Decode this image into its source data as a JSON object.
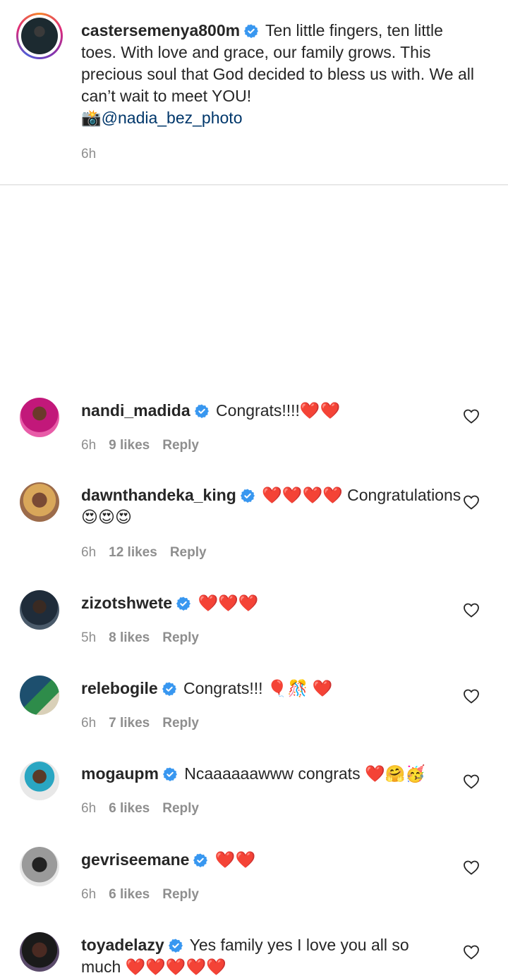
{
  "caption": {
    "username": "castersemenya800m",
    "text": "Ten little fingers, ten little toes. With love and grace, our family grows. This precious soul that God decided to bless us with. We all can’t wait to meet YOU!",
    "camera_emoji": "📸",
    "mention": "@nadia_bez_photo",
    "time": "6h"
  },
  "comments": [
    {
      "username": "nandi_madida",
      "text": "Congrats!!!!❤️❤️",
      "time": "6h",
      "likes": "9 likes",
      "reply": "Reply"
    },
    {
      "username": "dawnthandeka_king",
      "text": "❤️❤️❤️❤️ Congratulations 😍😍😍",
      "time": "6h",
      "likes": "12 likes",
      "reply": "Reply"
    },
    {
      "username": "zizotshwete",
      "text": "❤️❤️❤️",
      "time": "5h",
      "likes": "8 likes",
      "reply": "Reply"
    },
    {
      "username": "relebogile",
      "text": "Congrats!!! 🎈🎊 ❤️",
      "time": "6h",
      "likes": "7 likes",
      "reply": "Reply"
    },
    {
      "username": "mogaupm",
      "text": "Ncaaaaaawww congrats ❤️🤗🥳",
      "time": "6h",
      "likes": "6 likes",
      "reply": "Reply"
    },
    {
      "username": "gevriseemane",
      "text": "❤️❤️",
      "time": "6h",
      "likes": "6 likes",
      "reply": "Reply"
    },
    {
      "username": "toyadelazy",
      "text": "Yes family yes I love you all so much ❤️❤️❤️❤️❤️",
      "time": "",
      "likes": "",
      "reply": ""
    }
  ],
  "colors": {
    "verified": "#3897f0",
    "heart_emoji": "#e0245e",
    "meta_text": "#8e8e8e",
    "mention": "#00376b"
  },
  "icons": {
    "verified": "verified-badge-icon",
    "like": "heart-outline-icon"
  }
}
